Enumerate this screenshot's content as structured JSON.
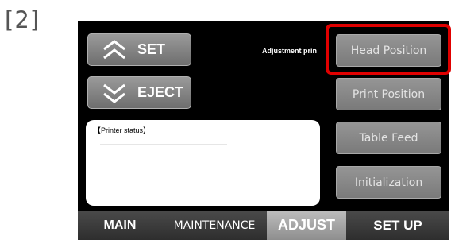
{
  "step_label": "[2]",
  "screen": {
    "set_button": {
      "label": "SET",
      "icon": "chevron-up-icon"
    },
    "eject_button": {
      "label": "EJECT",
      "icon": "chevron-down-icon"
    },
    "adjustment_label": "Adjustment prin",
    "printer_status": {
      "title": "【Printer status】"
    },
    "adjust_buttons": [
      {
        "label": "Head Position",
        "highlighted": true
      },
      {
        "label": "Print Position",
        "highlighted": false
      },
      {
        "label": "Table Feed",
        "highlighted": false
      },
      {
        "label": "Initialization",
        "highlighted": false
      }
    ],
    "tabs": [
      {
        "label": "MAIN",
        "active": false
      },
      {
        "label": "MAINTENANCE",
        "active": false
      },
      {
        "label": "ADJUST",
        "active": true
      },
      {
        "label": "SET UP",
        "active": false
      }
    ]
  },
  "colors": {
    "screen_background": "#000000",
    "button_gray": "#8a8a8a",
    "highlight_red": "#e00000",
    "active_tab": "#a6a6a6"
  }
}
